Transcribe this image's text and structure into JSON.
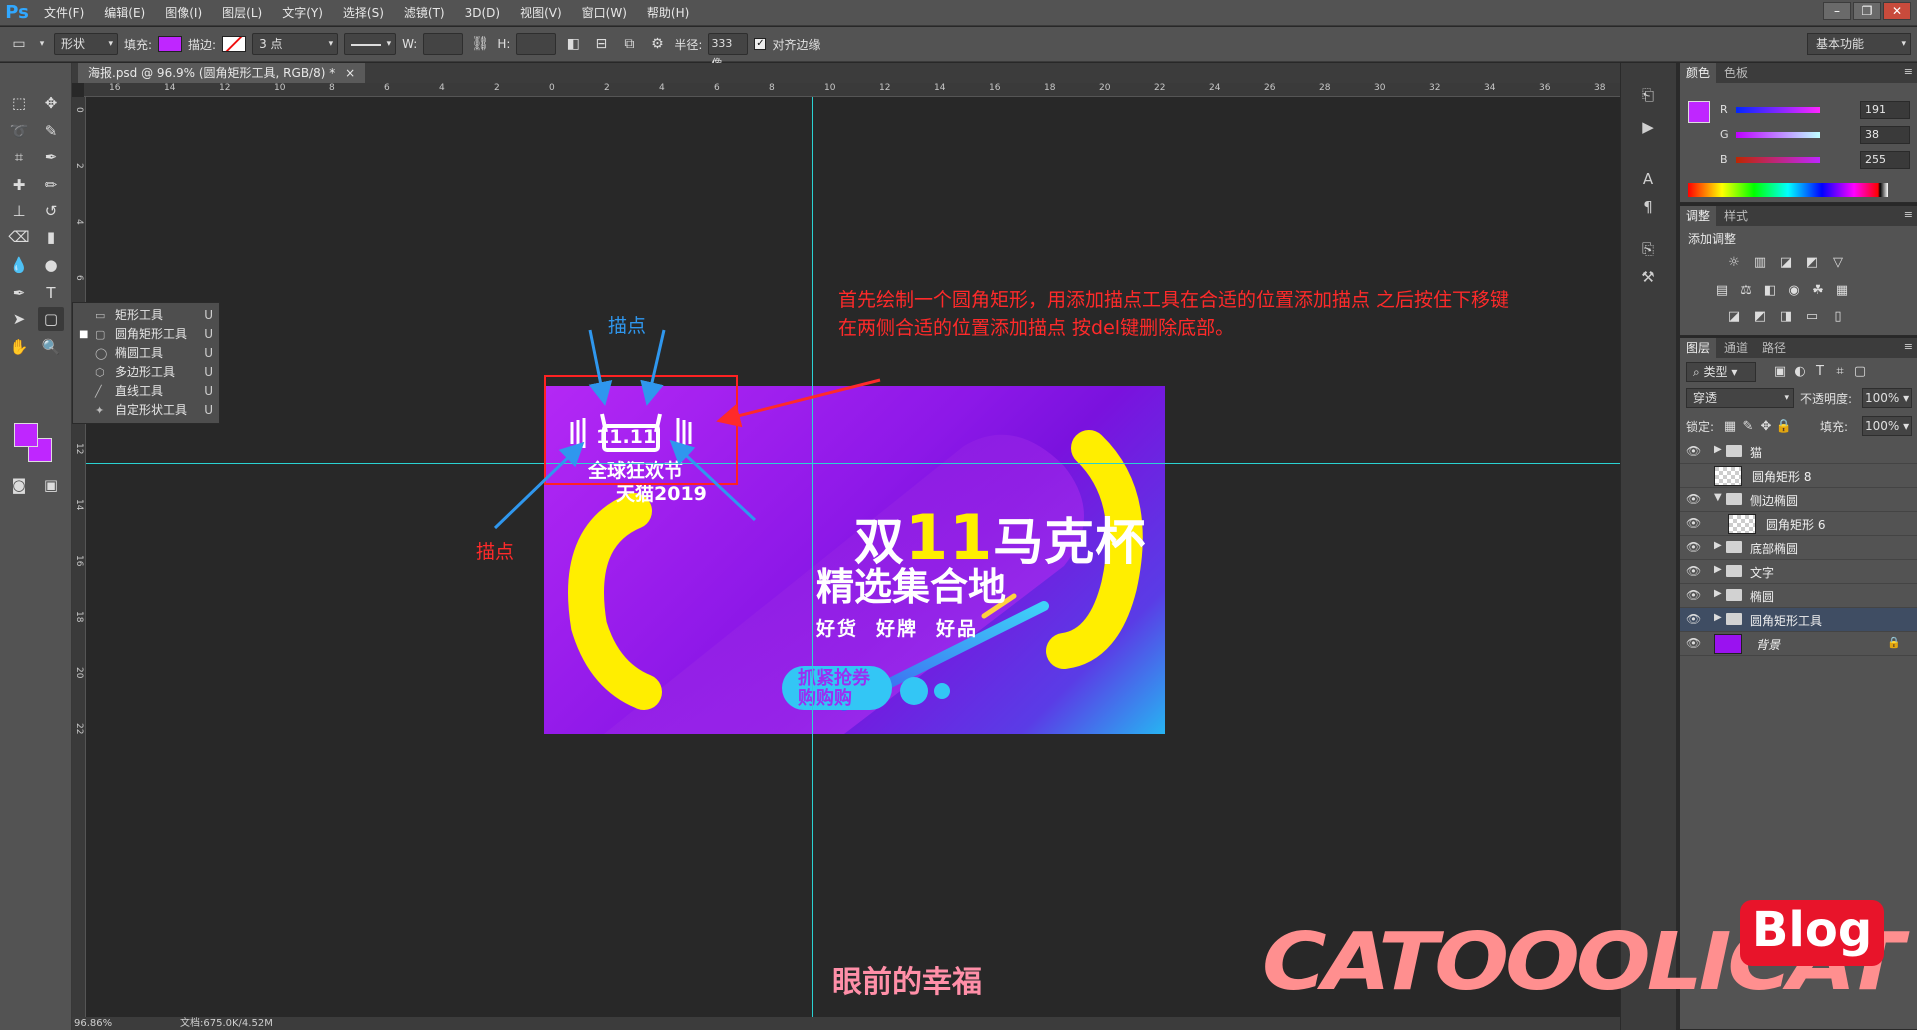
{
  "app": {
    "logo": "Ps",
    "menu": [
      "文件(F)",
      "编辑(E)",
      "图像(I)",
      "图层(L)",
      "文字(Y)",
      "选择(S)",
      "滤镜(T)",
      "3D(D)",
      "视图(V)",
      "窗口(W)",
      "帮助(H)"
    ]
  },
  "options": {
    "mode": "形状",
    "fill_label": "填充:",
    "stroke_label": "描边:",
    "stroke_width": "3 点",
    "w_label": "W:",
    "h_label": "H:",
    "radius_label": "半径:",
    "radius_value": "333 像",
    "align_edges": "对齐边缘",
    "workspace": "基本功能",
    "fill_color": "#bf26ff"
  },
  "document": {
    "tab": "海报.psd @ 96.9% (圆角矩形工具, RGB/8) *",
    "ruler_top": [
      "16",
      "14",
      "12",
      "10",
      "8",
      "6",
      "4",
      "2",
      "0",
      "2",
      "4",
      "6",
      "8",
      "10",
      "12",
      "14",
      "16",
      "18",
      "20",
      "22",
      "24",
      "26",
      "28",
      "30",
      "32",
      "34",
      "36",
      "38"
    ],
    "ruler_left": [
      "0",
      "2",
      "4",
      "6",
      "8",
      "10",
      "12",
      "14",
      "16",
      "18",
      "20",
      "22"
    ]
  },
  "flyout": {
    "items": [
      {
        "label": "矩形工具",
        "key": "U",
        "icon": "rect-icon",
        "selected": false
      },
      {
        "label": "圆角矩形工具",
        "key": "U",
        "icon": "rounded-rect-icon",
        "selected": true
      },
      {
        "label": "椭圆工具",
        "key": "U",
        "icon": "ellipse-icon",
        "selected": false
      },
      {
        "label": "多边形工具",
        "key": "U",
        "icon": "polygon-icon",
        "selected": false
      },
      {
        "label": "直线工具",
        "key": "U",
        "icon": "line-icon",
        "selected": false
      },
      {
        "label": "自定形状工具",
        "key": "U",
        "icon": "custom-shape-icon",
        "selected": false
      }
    ]
  },
  "poster": {
    "badge_top": "11.11",
    "badge_line2": "全球狂欢节",
    "badge_line3": "天猫2019",
    "title_a": "双",
    "title_num": "11",
    "title_b": "马克杯",
    "subtitle": "精选集合地",
    "tags": [
      "好货",
      "好牌",
      "好品"
    ],
    "pill_line1": "抓紧抢券",
    "pill_line2": "购购购",
    "colors": {
      "yellow": "#ffee00",
      "cyan": "#33c6f5",
      "purple": "#bf26ff"
    }
  },
  "annotations": {
    "instruction_line1": "首先绘制一个圆角矩形，用添加描点工具在合适的位置添加描点 之后按住下移键",
    "instruction_line2": "在两侧合适的位置添加描点 按del键删除底部。",
    "anchor_top": "描点",
    "anchor_left": "描点",
    "caption": "眼前的幸福",
    "watermark": "CATOOOLICAT",
    "blog": "Blog"
  },
  "status": {
    "zoom": "96.86%",
    "docinfo": "文档:675.0K/4.52M"
  },
  "panels": {
    "color_tabs": [
      "颜色",
      "色板"
    ],
    "r_label": "R",
    "g_label": "G",
    "b_label": "B",
    "r": "191",
    "g": "38",
    "b": "255",
    "adjust_tabs": [
      "调整",
      "样式"
    ],
    "adjust_title": "添加调整",
    "layers_tabs": [
      "图层",
      "通道",
      "路径"
    ],
    "kind": "类型",
    "blend": "穿透",
    "opacity_label": "不透明度:",
    "opacity": "100%",
    "lock_label": "锁定:",
    "fill_label": "填充:",
    "fill": "100%",
    "layers": [
      {
        "name": "猫",
        "type": "group",
        "visible": true,
        "indent": 0,
        "expanded": false
      },
      {
        "name": "圆角矩形 8",
        "type": "shape",
        "visible": false,
        "indent": 0,
        "expanded": false
      },
      {
        "name": "侧边椭圆",
        "type": "group",
        "visible": true,
        "indent": 0,
        "expanded": true
      },
      {
        "name": "圆角矩形 6",
        "type": "shape",
        "visible": true,
        "indent": 1,
        "expanded": false
      },
      {
        "name": "底部椭圆",
        "type": "group",
        "visible": true,
        "indent": 0,
        "expanded": false
      },
      {
        "name": "文字",
        "type": "group",
        "visible": true,
        "indent": 0,
        "expanded": false
      },
      {
        "name": "椭圆",
        "type": "group",
        "visible": true,
        "indent": 0,
        "expanded": false
      },
      {
        "name": "圆角矩形工具",
        "type": "group",
        "visible": true,
        "indent": 0,
        "expanded": false,
        "active": true
      },
      {
        "name": "背景",
        "type": "background",
        "visible": true,
        "indent": 0,
        "locked": true
      }
    ]
  }
}
